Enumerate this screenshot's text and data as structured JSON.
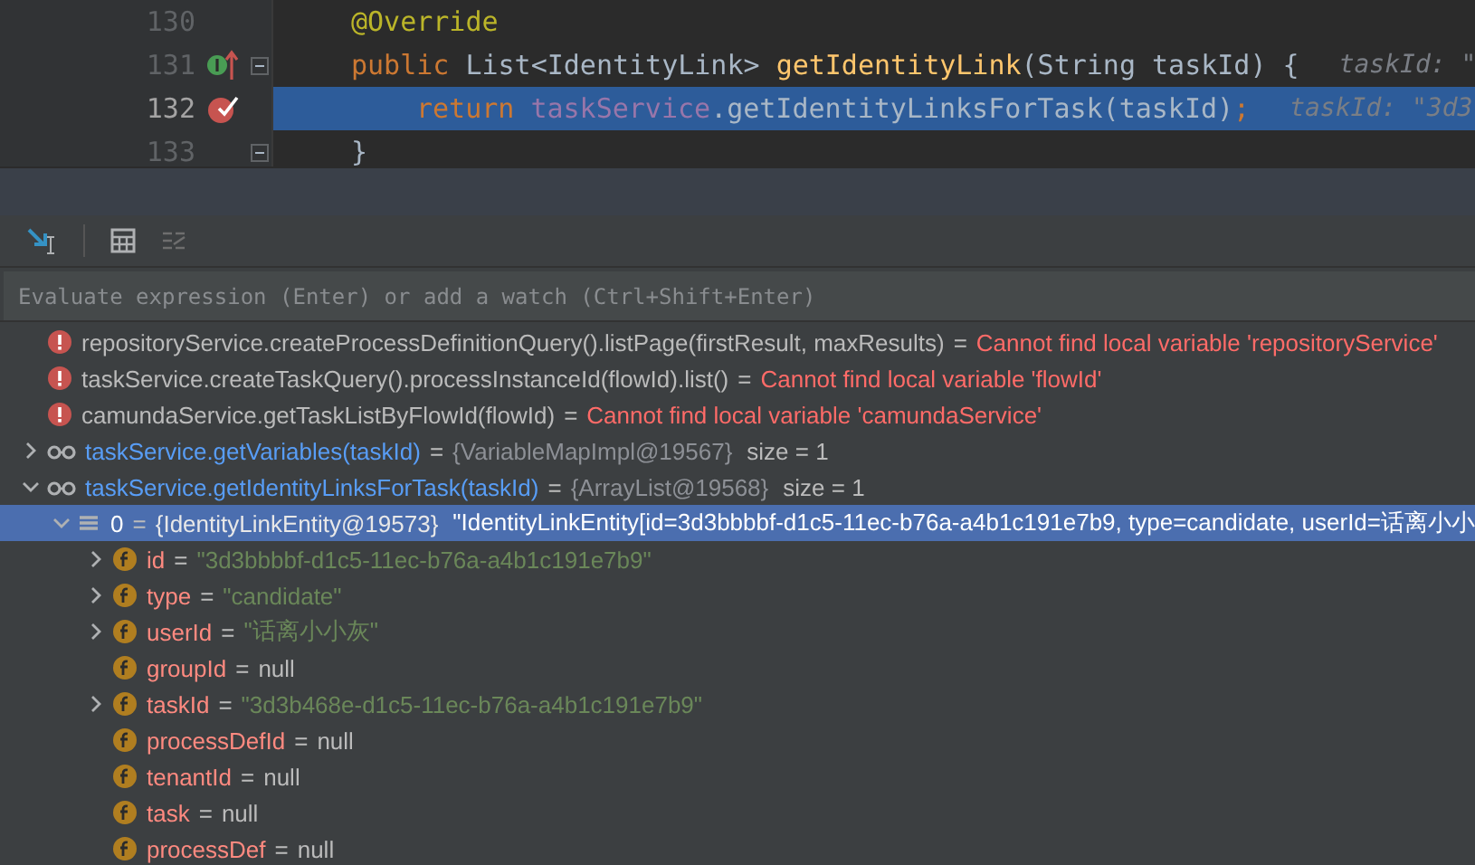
{
  "editor": {
    "lines": [
      {
        "number": "130",
        "implemented": false,
        "breakpoint": false,
        "current": false,
        "fold": false,
        "indented": false,
        "tokens": [
          {
            "text": "@Override",
            "kind": "annotation"
          }
        ]
      },
      {
        "number": "131",
        "implemented": true,
        "breakpoint": false,
        "current": false,
        "fold": true,
        "indented": false,
        "tokens": [
          {
            "text": "public",
            "kind": "keyword"
          },
          {
            "text": " List<IdentityLink> ",
            "kind": "plain"
          },
          {
            "text": "getIdentityLink",
            "kind": "method"
          },
          {
            "text": "(String taskId) {",
            "kind": "plain"
          }
        ],
        "hint": "taskId: \""
      },
      {
        "number": "132",
        "implemented": false,
        "breakpoint": true,
        "current": true,
        "fold": false,
        "indented": true,
        "tokens": [
          {
            "text": "return ",
            "kind": "keyword"
          },
          {
            "text": "taskService",
            "kind": "field"
          },
          {
            "text": ".getIdentityLinksForTask(taskId)",
            "kind": "plain"
          },
          {
            "text": ";",
            "kind": "keyword"
          }
        ],
        "hint": "taskId: \"3d3"
      },
      {
        "number": "133",
        "implemented": false,
        "breakpoint": false,
        "current": false,
        "fold": true,
        "indented": false,
        "tokens": [
          {
            "text": "}",
            "kind": "plain"
          }
        ]
      }
    ]
  },
  "watches": {
    "placeholder": "Evaluate expression (Enter) or add a watch (Ctrl+Shift+Enter)",
    "items": [
      {
        "kind": "error",
        "expandable": false,
        "selected": false,
        "name": "repositoryService.createProcessDefinitionQuery().listPage(firstResult, maxResults)",
        "op": "=",
        "value": "Cannot find local variable 'repositoryService'"
      },
      {
        "kind": "error",
        "expandable": false,
        "selected": false,
        "name": "taskService.createTaskQuery().processInstanceId(flowId).list()",
        "op": "=",
        "value": "Cannot find local variable 'flowId'"
      },
      {
        "kind": "error",
        "expandable": false,
        "selected": false,
        "name": "camundaService.getTaskListByFlowId(flowId)",
        "op": "=",
        "value": "Cannot find local variable 'camundaService'"
      },
      {
        "kind": "watch",
        "expandable": true,
        "expanded": false,
        "selected": false,
        "name": "taskService.getVariables(taskId)",
        "op": "=",
        "value": "{VariableMapImpl@19567}",
        "extra": "size = 1"
      },
      {
        "kind": "watch",
        "expandable": true,
        "expanded": true,
        "selected": false,
        "name": "taskService.getIdentityLinksForTask(taskId)",
        "op": "=",
        "value": "{ArrayList@19568}",
        "extra": "size = 1",
        "children": [
          {
            "kind": "element",
            "expandable": true,
            "expanded": true,
            "selected": true,
            "name": "0",
            "op": "=",
            "value": "{IdentityLinkEntity@19573}",
            "extra": "\"IdentityLinkEntity[id=3d3bbbbf-d1c5-11ec-b76a-a4b1c191e7b9, type=candidate, userId=话离小小",
            "children": [
              {
                "kind": "string",
                "expandable": true,
                "expanded": false,
                "selected": false,
                "name": "id",
                "op": "=",
                "value": "\"3d3bbbbf-d1c5-11ec-b76a-a4b1c191e7b9\""
              },
              {
                "kind": "string",
                "expandable": true,
                "expanded": false,
                "selected": false,
                "name": "type",
                "op": "=",
                "value": "\"candidate\""
              },
              {
                "kind": "string",
                "expandable": true,
                "expanded": false,
                "selected": false,
                "name": "userId",
                "op": "=",
                "value": "\"话离小小灰\""
              },
              {
                "kind": "null",
                "expandable": false,
                "selected": false,
                "name": "groupId",
                "op": "=",
                "value": "null"
              },
              {
                "kind": "string",
                "expandable": true,
                "expanded": false,
                "selected": false,
                "name": "taskId",
                "op": "=",
                "value": "\"3d3b468e-d1c5-11ec-b76a-a4b1c191e7b9\""
              },
              {
                "kind": "null",
                "expandable": false,
                "selected": false,
                "name": "processDefId",
                "op": "=",
                "value": "null"
              },
              {
                "kind": "null",
                "expandable": false,
                "selected": false,
                "name": "tenantId",
                "op": "=",
                "value": "null"
              },
              {
                "kind": "null",
                "expandable": false,
                "selected": false,
                "name": "task",
                "op": "=",
                "value": "null"
              },
              {
                "kind": "null",
                "expandable": false,
                "selected": false,
                "name": "processDef",
                "op": "=",
                "value": "null"
              }
            ]
          }
        ]
      }
    ]
  }
}
